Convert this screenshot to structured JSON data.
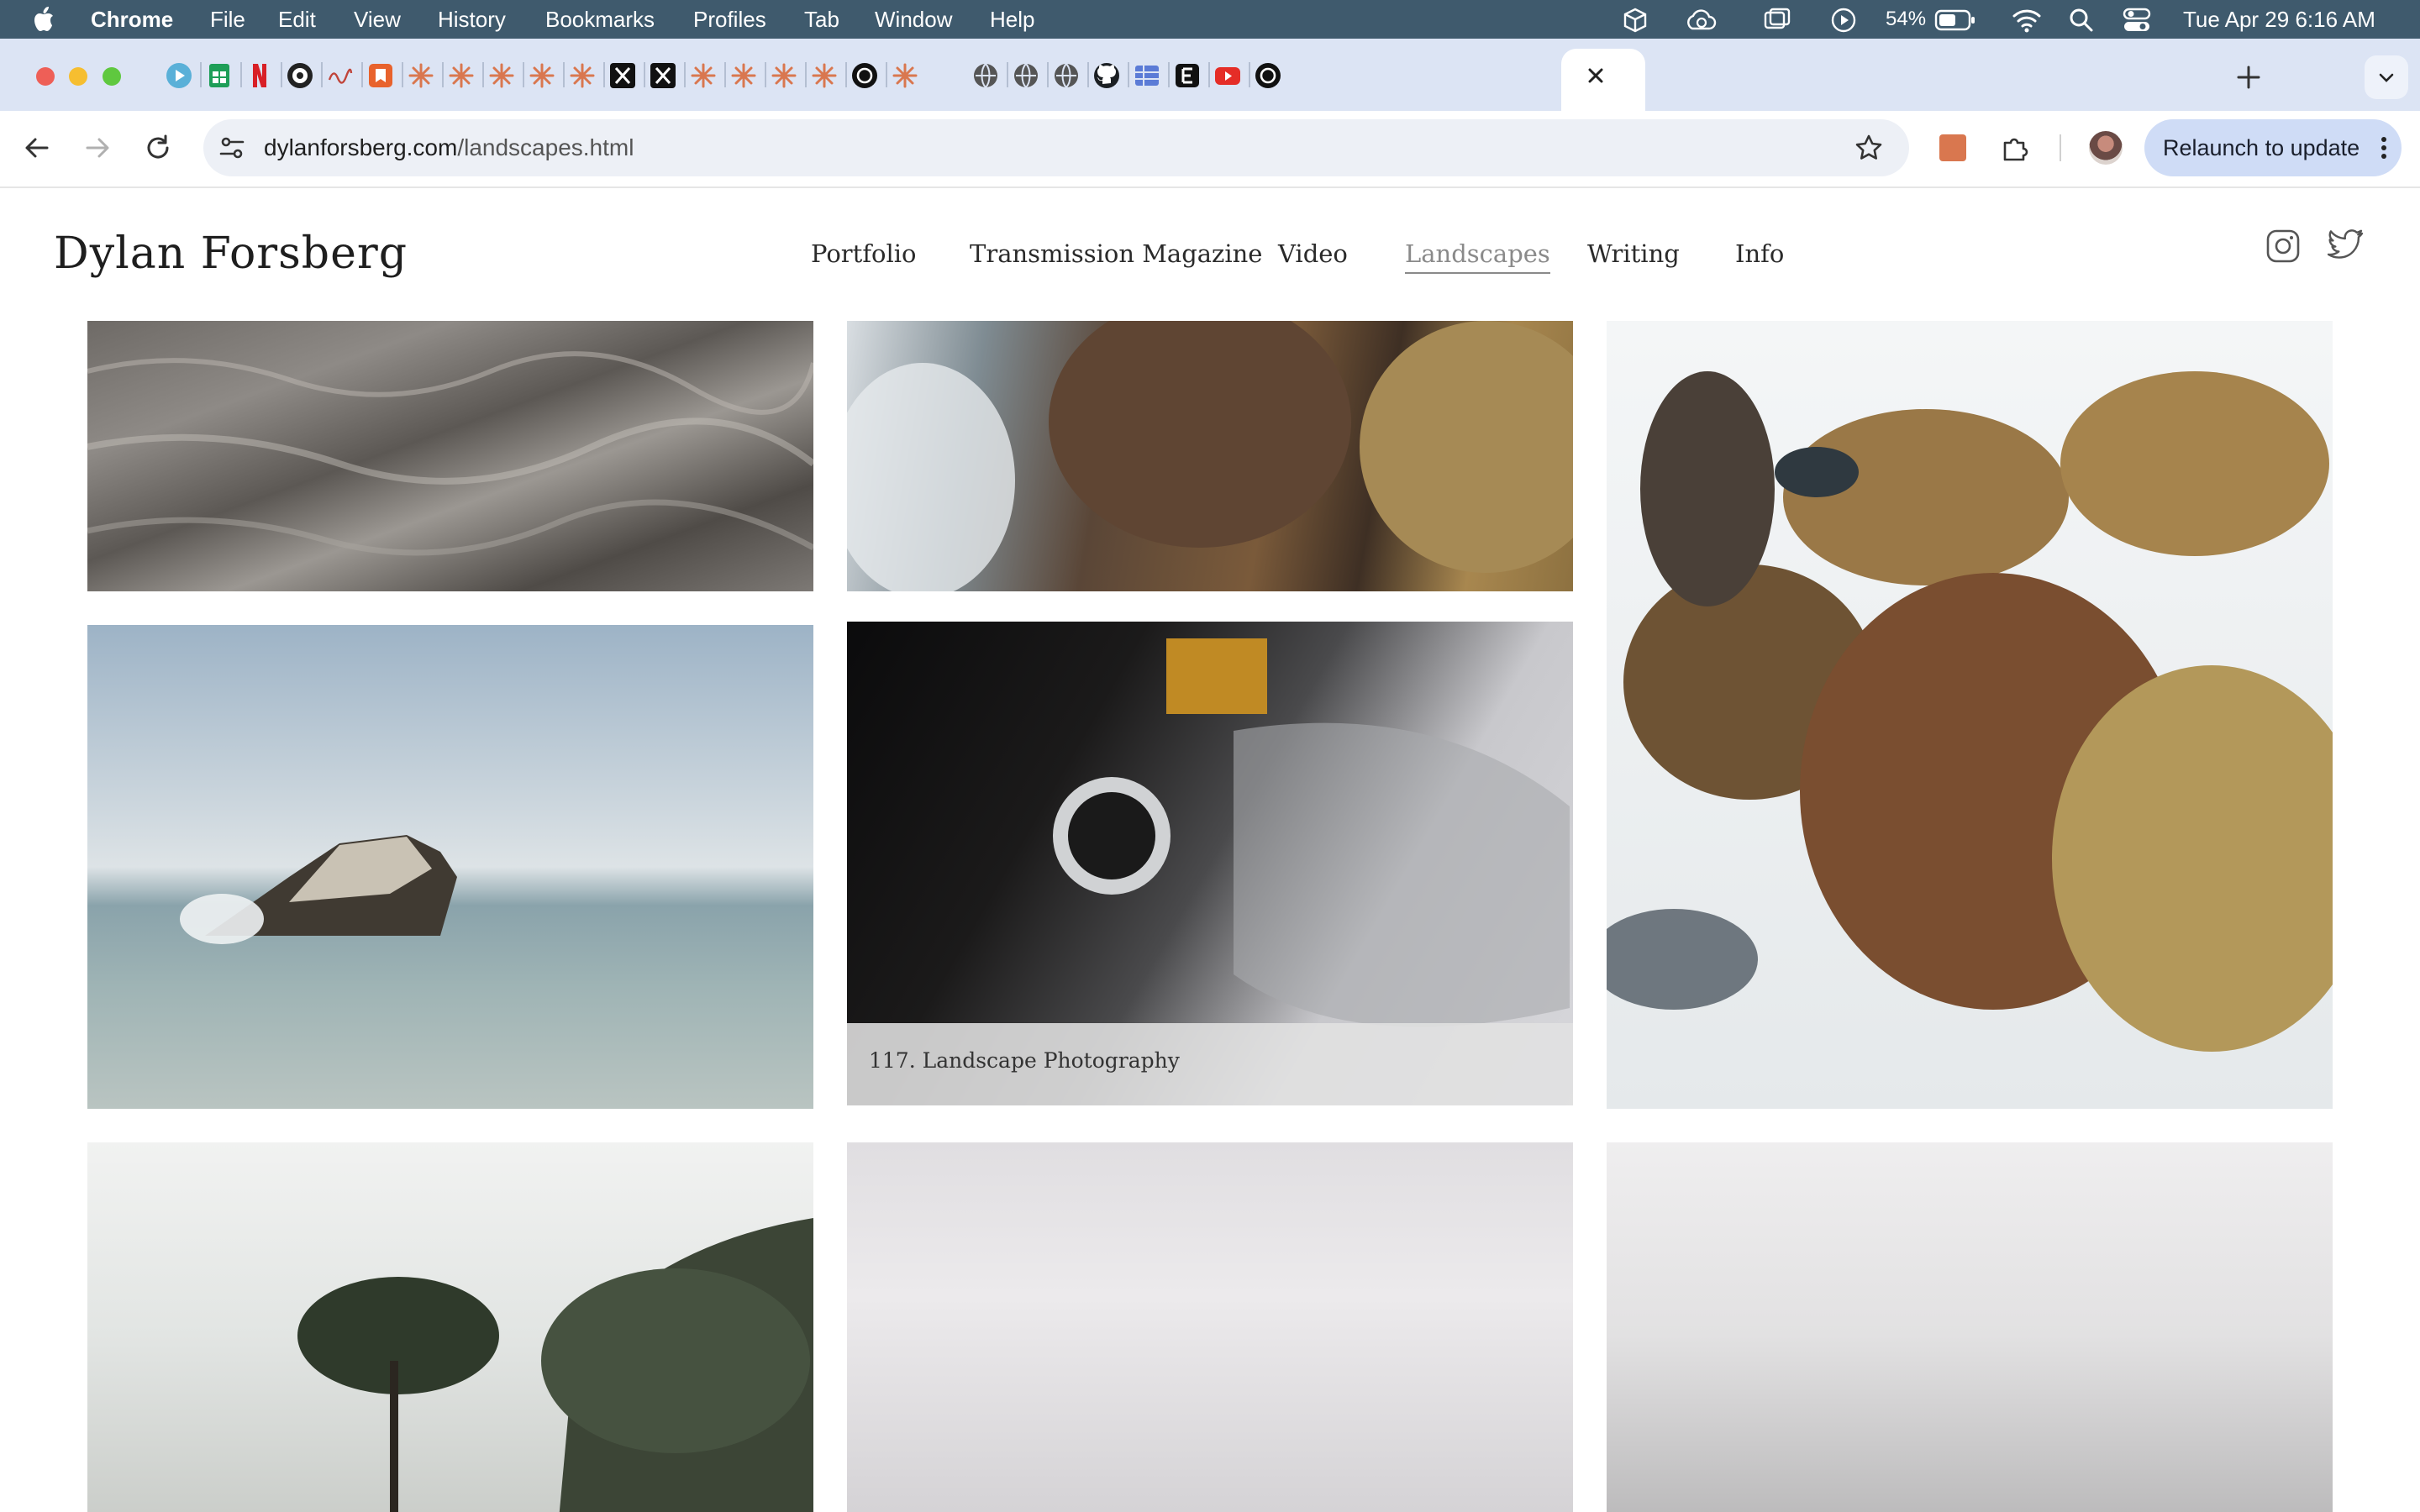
{
  "menubar": {
    "app": "Chrome",
    "menus": [
      "File",
      "Edit",
      "View",
      "History",
      "Bookmarks",
      "Profiles",
      "Tab",
      "Window",
      "Help"
    ],
    "battery": "54%",
    "datetime": "Tue Apr 29  6:16 AM"
  },
  "tabs": {
    "favicons": [
      "play-icon",
      "sheets-icon",
      "netflix-icon",
      "aperture-icon",
      "squiggle-icon",
      "bookmark-icon",
      "claude-icon",
      "claude-icon",
      "claude-icon",
      "claude-icon",
      "claude-icon",
      "x-icon",
      "x-icon",
      "claude-icon",
      "claude-icon",
      "claude-icon",
      "claude-icon",
      "openai-icon",
      "claude-icon",
      "close-icon",
      "globe-icon",
      "globe-icon",
      "globe-icon",
      "github-icon",
      "grid-icon",
      "e-icon",
      "youtube-icon",
      "openai-icon"
    ],
    "new_tab": "+"
  },
  "toolbar": {
    "url_host": "dylanforsberg.com",
    "url_path": "/landscapes.html",
    "relaunch_label": "Relaunch to update"
  },
  "site": {
    "title": "Dylan Forsberg",
    "nav": [
      "Portfolio",
      "Transmission Magazine",
      "Video",
      "Landscapes",
      "Writing",
      "Info"
    ],
    "active_nav": "Landscapes"
  },
  "gallery": {
    "caption": "117. Landscape Photography",
    "photos": [
      "water-ripples-photo",
      "foam-rocks-photo",
      "rocks-surf-photo",
      "sea-rock-photo",
      "motorcycle-gauge-photo",
      "trees-sky-photo",
      "haze-photo",
      "fog-photo"
    ]
  },
  "colors": {
    "menubar": "#3f5a6d",
    "tabstrip": "#dce4f4",
    "omnibox": "#edf0f6",
    "relaunch": "#cfdcf6",
    "claude_accent": "#d9774f"
  }
}
